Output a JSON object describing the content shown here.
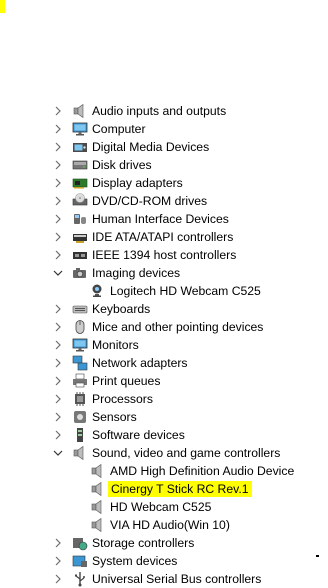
{
  "tree": {
    "categories": [
      {
        "label": "Audio inputs and outputs",
        "expanded": false,
        "icon": "speaker-icon"
      },
      {
        "label": "Computer",
        "expanded": false,
        "icon": "monitor-icon"
      },
      {
        "label": "Digital Media Devices",
        "expanded": false,
        "icon": "media-device-icon"
      },
      {
        "label": "Disk drives",
        "expanded": false,
        "icon": "disk-drive-icon"
      },
      {
        "label": "Display adapters",
        "expanded": false,
        "icon": "display-adapter-icon"
      },
      {
        "label": "DVD/CD-ROM drives",
        "expanded": false,
        "icon": "optical-drive-icon"
      },
      {
        "label": "Human Interface Devices",
        "expanded": false,
        "icon": "hid-icon"
      },
      {
        "label": "IDE ATA/ATAPI controllers",
        "expanded": false,
        "icon": "ide-controller-icon"
      },
      {
        "label": "IEEE 1394 host controllers",
        "expanded": false,
        "icon": "ieee1394-icon"
      },
      {
        "label": "Imaging devices",
        "expanded": true,
        "icon": "camera-icon",
        "children": [
          {
            "label": "Logitech HD Webcam C525",
            "icon": "webcam-icon"
          }
        ]
      },
      {
        "label": "Keyboards",
        "expanded": false,
        "icon": "keyboard-icon"
      },
      {
        "label": "Mice and other pointing devices",
        "expanded": false,
        "icon": "mouse-icon"
      },
      {
        "label": "Monitors",
        "expanded": false,
        "icon": "monitor-icon"
      },
      {
        "label": "Network adapters",
        "expanded": false,
        "icon": "network-icon"
      },
      {
        "label": "Print queues",
        "expanded": false,
        "icon": "printer-icon"
      },
      {
        "label": "Processors",
        "expanded": false,
        "icon": "processor-icon"
      },
      {
        "label": "Sensors",
        "expanded": false,
        "icon": "sensor-icon"
      },
      {
        "label": "Software devices",
        "expanded": false,
        "icon": "software-device-icon"
      },
      {
        "label": "Sound, video and game controllers",
        "expanded": true,
        "icon": "speaker-icon",
        "children": [
          {
            "label": "AMD High Definition Audio Device",
            "icon": "speaker-icon"
          },
          {
            "label": "Cinergy T Stick RC Rev.1",
            "icon": "speaker-icon",
            "selected": true
          },
          {
            "label": "HD Webcam C525",
            "icon": "speaker-icon"
          },
          {
            "label": "VIA HD Audio(Win 10)",
            "icon": "speaker-icon"
          }
        ]
      },
      {
        "label": "Storage controllers",
        "expanded": false,
        "icon": "storage-controller-icon"
      },
      {
        "label": "System devices",
        "expanded": false,
        "icon": "system-device-icon"
      },
      {
        "label": "Universal Serial Bus controllers",
        "expanded": false,
        "icon": "usb-icon"
      }
    ]
  },
  "colors": {
    "highlight": "#ffff00",
    "text": "#000000",
    "chevron": "#6d6d6d"
  }
}
